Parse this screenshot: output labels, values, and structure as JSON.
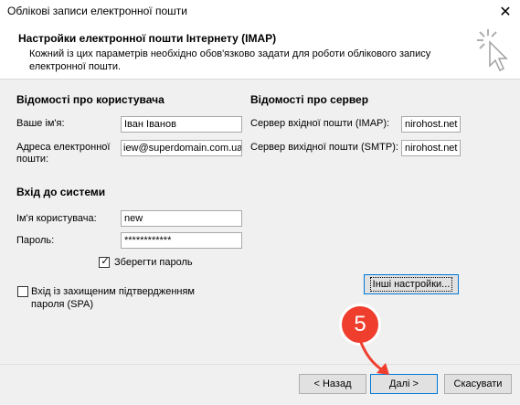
{
  "window": {
    "title": "Облікові записи електронної пошти",
    "close_glyph": "✕"
  },
  "header": {
    "title": "Настройки електронної пошти Інтернету (IMAP)",
    "description": "Кожний із цих параметрів необхідно обов'язково задати для роботи облікового запису електронної пошти."
  },
  "user_info": {
    "heading": "Відомості про користувача",
    "name_label": "Ваше ім'я:",
    "name_value": "Іван Іванов",
    "email_label_line1": "Адреса електронної",
    "email_label_line2": "пошти:",
    "email_value": "iew@superdomain.com.ua"
  },
  "server_info": {
    "heading": "Відомості про сервер",
    "incoming_label": "Сервер вхідної пошти (IMAP):",
    "incoming_value": "nirohost.net",
    "outgoing_label": "Сервер вихідної пошти (SMTP):",
    "outgoing_value": "nirohost.net"
  },
  "login": {
    "heading": "Вхід до системи",
    "username_label": "Ім'я користувача:",
    "username_value": "new",
    "password_label": "Пароль:",
    "password_value": "************",
    "remember_label": "Зберегти пароль",
    "remember_checked": true,
    "spa_label_line1": "Вхід із захищеним підтвердженням",
    "spa_label_line2": "пароля (SPA)",
    "spa_checked": false
  },
  "buttons": {
    "more_settings": "Інші настройки...",
    "back": "< Назад",
    "next": "Далі >",
    "cancel": "Скасувати"
  },
  "annotation": {
    "step_number": "5",
    "badge_color": "#ef3e2e"
  }
}
